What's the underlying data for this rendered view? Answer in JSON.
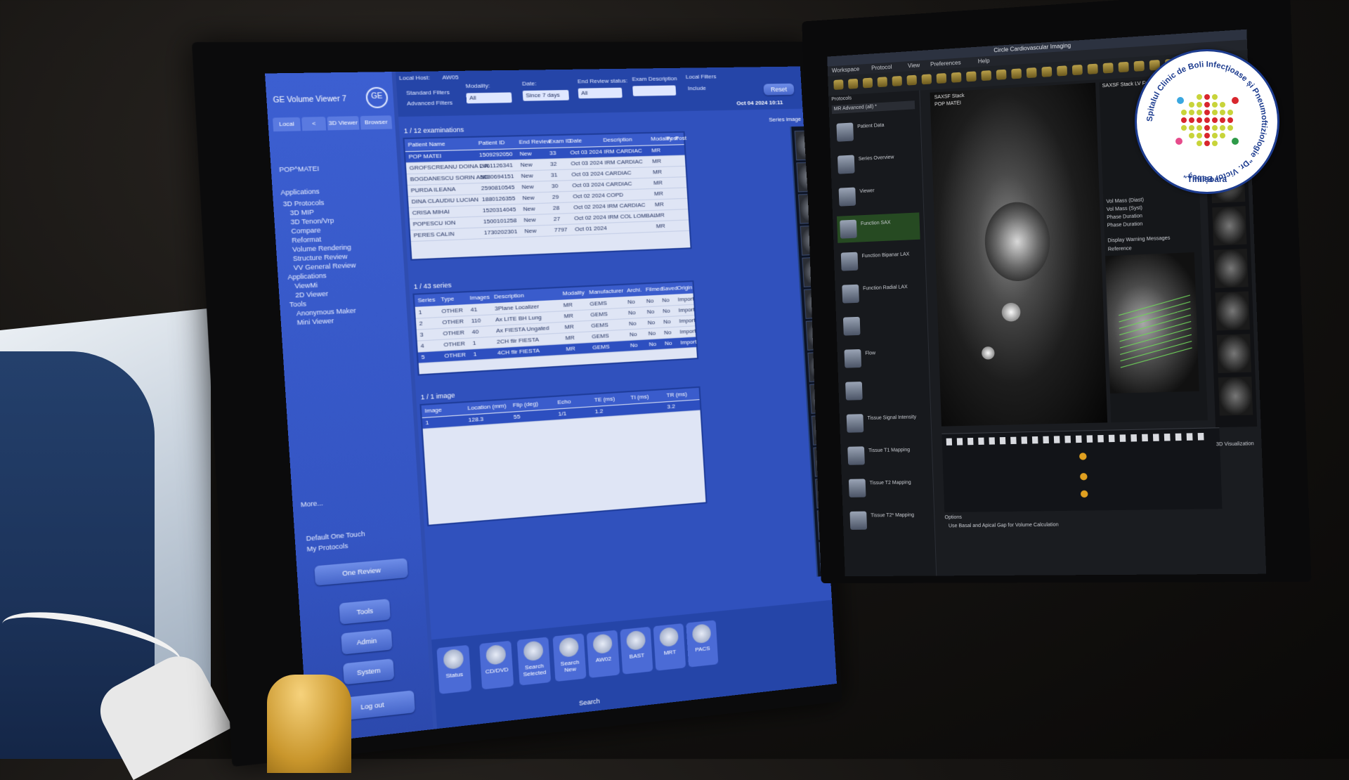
{
  "left_monitor": {
    "app_title": "GE Volume Viewer 7",
    "logo_text": "GE",
    "tabs": [
      "Local",
      "<",
      "3D Viewer",
      "Browser"
    ],
    "patient_label": "POP^MATEI",
    "protocols_header": "Applications",
    "protocols": [
      "3D Protocols",
      "3D MIP",
      "3D Tenon/Vrp",
      "Compare",
      "Reformat",
      "Volume Rendering",
      "Structure Review",
      "VV General Review",
      "Applications",
      "ViewMi",
      "2D Viewer",
      "Tools",
      "Anonymous Maker",
      "Mini Viewer"
    ],
    "more_label": "More...",
    "one_touch": [
      "Default One Touch",
      "My Protocols"
    ],
    "one_review_btn": "One Review",
    "side_buttons": [
      "Tools",
      "Admin",
      "System"
    ],
    "logout_btn": "Log out",
    "filters": {
      "local_host_label": "Local Host:",
      "local_host_value": "AW05",
      "standard_filters": "Standard Filters",
      "advanced_filters": "Advanced Filters",
      "modality_label": "Modality:",
      "modality_value": "All",
      "date_label": "Date:",
      "date_value": "Since 7 days",
      "review_label": "End Review status:",
      "review_value": "All",
      "exam_desc_label": "Exam Description",
      "local_filters_label": "Local Filters",
      "include_label": "Include",
      "reset_btn": "Reset",
      "datetime": "Oct 04 2024 10:11"
    },
    "exams": {
      "title": "1 / 12 examinations",
      "columns": [
        "Patient Name",
        "Patient ID",
        "End Review",
        "Exam ID",
        "Date",
        "Description",
        "Modality",
        "Post",
        "Post"
      ],
      "rows": [
        [
          "POP MATEI",
          "1509292050",
          "New",
          "33",
          "Oct 03 2024",
          "IRM CARDIAC",
          "MR"
        ],
        [
          "GROFSCREANU DOINA LIA",
          "2461126341",
          "New",
          "32",
          "Oct 03 2024",
          "IRM CARDIAC",
          "MR"
        ],
        [
          "BOGDANESCU SORIN AND",
          "5030694151",
          "New",
          "31",
          "Oct 03 2024",
          "CARDIAC",
          "MR"
        ],
        [
          "PURDA ILEANA",
          "2590810545",
          "New",
          "30",
          "Oct 03 2024",
          "CARDIAC",
          "MR"
        ],
        [
          "DINA CLAUDIU LUCIAN",
          "1880126355",
          "New",
          "29",
          "Oct 02 2024",
          "COPD",
          "MR"
        ],
        [
          "CRISA MIHAI",
          "1520314045",
          "New",
          "28",
          "Oct 02 2024",
          "IRM CARDIAC",
          "MR"
        ],
        [
          "POPESCU ION",
          "1500101258",
          "New",
          "27",
          "Oct 02 2024",
          "IRM COL LOMBAL",
          "MR"
        ],
        [
          "PERES CALIN",
          "1730202301",
          "New",
          "7797",
          "Oct 01 2024",
          "",
          "MR"
        ]
      ]
    },
    "series": {
      "title": "1 / 43 series",
      "columns": [
        "Series",
        "Type",
        "Images",
        "Description",
        "Modality",
        "Manufacturer",
        "Archi.",
        "Filmed",
        "Saved",
        "Origin"
      ],
      "rows": [
        [
          "1",
          "OTHER",
          "41",
          "3Plane Localizer",
          "MR",
          "GEMS",
          "No",
          "No",
          "No",
          "Import"
        ],
        [
          "2",
          "OTHER",
          "110",
          "Ax LITE BH Lung",
          "MR",
          "GEMS",
          "No",
          "No",
          "No",
          "Import"
        ],
        [
          "3",
          "OTHER",
          "40",
          "Ax FIESTA Ungated",
          "MR",
          "GEMS",
          "No",
          "No",
          "No",
          "Import"
        ],
        [
          "4",
          "OTHER",
          "1",
          "2CH fiir FIESTA",
          "MR",
          "GEMS",
          "No",
          "No",
          "No",
          "Import"
        ],
        [
          "5",
          "OTHER",
          "1",
          "4CH fiir FIESTA",
          "MR",
          "GEMS",
          "No",
          "No",
          "No",
          "Import"
        ]
      ]
    },
    "images": {
      "title": "1 / 1 image",
      "columns": [
        "Image",
        "Location (mm)",
        "Flip (deg)",
        "Echo",
        "TE (ms)",
        "TI (ms)",
        "TR (ms)"
      ],
      "rows": [
        [
          "1",
          "128.3",
          "55",
          "1/1",
          "1.2",
          "",
          "3.2"
        ]
      ]
    },
    "series_image_label": "Series image",
    "bottom_tools": [
      {
        "icon": "disc-icon",
        "label": "Status"
      },
      {
        "icon": "cd-dvd-icon",
        "label": "CD/DVD"
      },
      {
        "icon": "search-selected-icon",
        "label": "Search Selected"
      },
      {
        "icon": "search-new-icon",
        "label": "Search New"
      },
      {
        "icon": "scanner-icon",
        "label": "AW02"
      },
      {
        "icon": "scanner-icon",
        "label": "BAST"
      },
      {
        "icon": "scanner-icon",
        "label": "MRT"
      },
      {
        "icon": "pacs-icon",
        "label": "PACS"
      }
    ],
    "search_label": "Search"
  },
  "right_monitor": {
    "title": "Circle Cardiovascular Imaging",
    "menu": [
      "Workspace",
      "Protocol",
      "View",
      "Preferences",
      "Help"
    ],
    "protocols_label": "Protocols",
    "protocol_select": "MR Advanced (all) *",
    "sidebar": [
      {
        "icon": "patient-data-icon",
        "label": "Patient Data"
      },
      {
        "icon": "series-overview-icon",
        "label": "Series Overview"
      },
      {
        "icon": "viewer-icon",
        "label": "Viewer"
      },
      {
        "icon": "function-sax-icon",
        "label": "Function SAX",
        "active": true
      },
      {
        "icon": "function-lax-icon",
        "label": "Function Bipanar LAX"
      },
      {
        "icon": "function-radial-icon",
        "label": "Function Radial LAX"
      },
      {
        "icon": "3d-icon",
        "label": ""
      },
      {
        "icon": "flow-icon",
        "label": "Flow"
      },
      {
        "icon": "strain-icon",
        "label": ""
      },
      {
        "icon": "tissue-signal-icon",
        "label": "Tissue Signal Intensity"
      },
      {
        "icon": "t1-icon",
        "label": "Tissue T1 Mapping"
      },
      {
        "icon": "t2-icon",
        "label": "Tissue T2 Mapping"
      },
      {
        "icon": "t2star-icon",
        "label": "Tissue T2* Mapping"
      }
    ],
    "series_label": "SAXSF Stack",
    "patient_overlay": "POP MATEI",
    "right_panel_title": "SAXSF Stack LV Function",
    "right_panel_items": [
      "Vol Mass (Diast)",
      "Vol Mass (Syst)",
      "Phase Duration",
      "Phase Duration"
    ],
    "display_options": "Display Warning Messages",
    "reference_label": "Reference",
    "options_label": "Options",
    "checkbox_label": "Use Basal and Apical Gap for Volume Calculation",
    "visualization_label": "3D Visualization"
  },
  "logo": {
    "ring_text": "Spitalul Clinic de Boli Infecțioase și Pneumoftiziologie \"Dr. Victor Babeș\"",
    "city": "Timișoara",
    "ring_color": "#1d3c8f",
    "cross_color": "#d8262d",
    "dot_color": "#c8d43a"
  }
}
